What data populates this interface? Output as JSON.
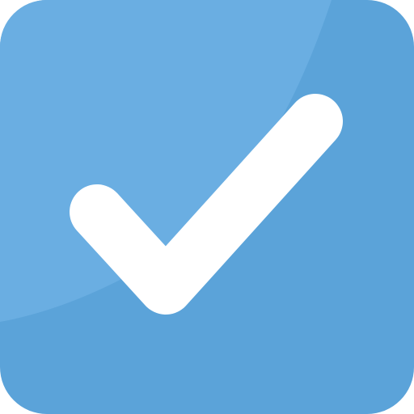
{
  "icon": {
    "name": "checkmark-icon",
    "colors": {
      "base": "#5ba3d9",
      "highlight": "#6aaee2",
      "check": "#ffffff"
    }
  }
}
